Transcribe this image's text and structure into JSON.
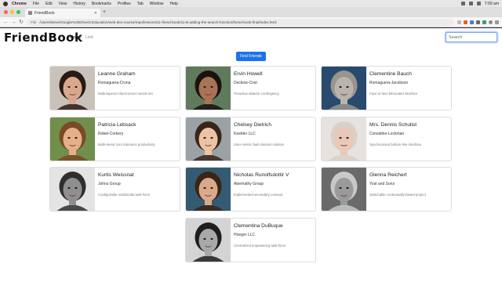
{
  "menubar": {
    "app": "Chrome",
    "items": [
      "File",
      "Edit",
      "View",
      "History",
      "Bookmarks",
      "Profiles",
      "Tab",
      "Window",
      "Help"
    ],
    "clock": "7:59 am"
  },
  "browser": {
    "tab_title": "FriendBook",
    "url_prefix": "File",
    "url": "/Users/steve/Google%20Drive/2.Education/web-dev-course/repo/lessons/11-friend-book/11-B-adding-the-search-function/friend-book-final/index.html"
  },
  "navbar": {
    "brand": "FriendBook",
    "links": [
      "Home",
      "Link"
    ],
    "search_placeholder": "Search"
  },
  "find_button": "Find Friends",
  "friends": [
    {
      "name": "Leanne Graham",
      "company": "Romaguera-Crona",
      "phrase": "Multi-layered client-server neural-net",
      "skin": "#d9a88c",
      "hair": "#2a1a14",
      "bg": "#c9c2bb"
    },
    {
      "name": "Ervin Howell",
      "company": "Deckow-Crist",
      "phrase": "Proactive didactic contingency",
      "skin": "#a87356",
      "hair": "#1b120e",
      "bg": "#5f7a5c"
    },
    {
      "name": "Clementine Bauch",
      "company": "Romaguera-Jacobson",
      "phrase": "Face to face bifurcated interface",
      "skin": "#b9b4ad",
      "hair": "#9a948e",
      "bg": "#284a6e"
    },
    {
      "name": "Patricia Lebsack",
      "company": "Robel-Corkery",
      "phrase": "Multi-tiered zero tolerance productivity",
      "skin": "#e3b08a",
      "hair": "#7a4a26",
      "bg": "#6f8f4a"
    },
    {
      "name": "Chelsey Dietrich",
      "company": "Keebler LLC",
      "phrase": "User-centric fault-tolerant solution",
      "skin": "#ecc3a6",
      "hair": "#3a2418",
      "bg": "#9aa2a5"
    },
    {
      "name": "Mrs. Dennis Schulist",
      "company": "Considine-Lockman",
      "phrase": "Synchronised bottom-line interface",
      "skin": "#e8c9b8",
      "hair": "#d9d0c8",
      "bg": "#e6e2df"
    },
    {
      "name": "Kurtis Weissnat",
      "company": "Johns Group",
      "phrase": "Configurable multimedia task-force",
      "skin": "#8f8f8f",
      "hair": "#2f2f2f",
      "bg": "#e4e4e4"
    },
    {
      "name": "Nicholas Runolfsdottir V",
      "company": "Abernathy Group",
      "phrase": "Implemented secondary concept",
      "skin": "#d8a98a",
      "hair": "#3b2416",
      "bg": "#355a73"
    },
    {
      "name": "Glenna Reichert",
      "company": "Yost and Sons",
      "phrase": "Switchable contextually-based project",
      "skin": "#9a9a9a",
      "hair": "#c9c9c9",
      "bg": "#6a6a6a"
    },
    {
      "name": "Clementina DuBuque",
      "company": "Hoeger LLC",
      "phrase": "Centralized empowering task-force",
      "skin": "#a9a9a9",
      "hair": "#1e1e1e",
      "bg": "#d4d4d4"
    }
  ],
  "colors": {
    "accent": "#1d72e8",
    "traffic_red": "#fd5f57",
    "traffic_yellow": "#febc2e",
    "traffic_green": "#29c840"
  }
}
